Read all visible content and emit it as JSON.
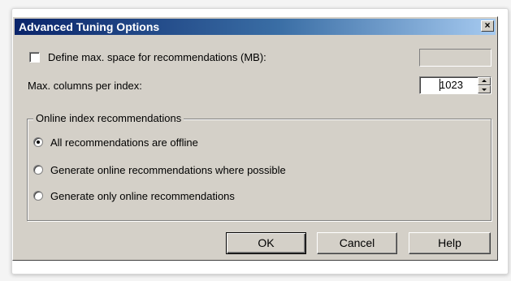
{
  "dialog": {
    "title": "Advanced Tuning Options",
    "close_glyph": "×"
  },
  "max_space": {
    "label": "Define max. space for recommendations (MB):",
    "checked": false,
    "value": ""
  },
  "max_columns": {
    "label": "Max. columns per index:",
    "value": "1023"
  },
  "online_group": {
    "title": "Online index recommendations",
    "options": [
      {
        "label": "All recommendations are offline",
        "selected": true
      },
      {
        "label": "Generate online recommendations where possible",
        "selected": false
      },
      {
        "label": "Generate only online recommendations",
        "selected": false
      }
    ]
  },
  "buttons": {
    "ok": "OK",
    "cancel": "Cancel",
    "help": "Help"
  }
}
